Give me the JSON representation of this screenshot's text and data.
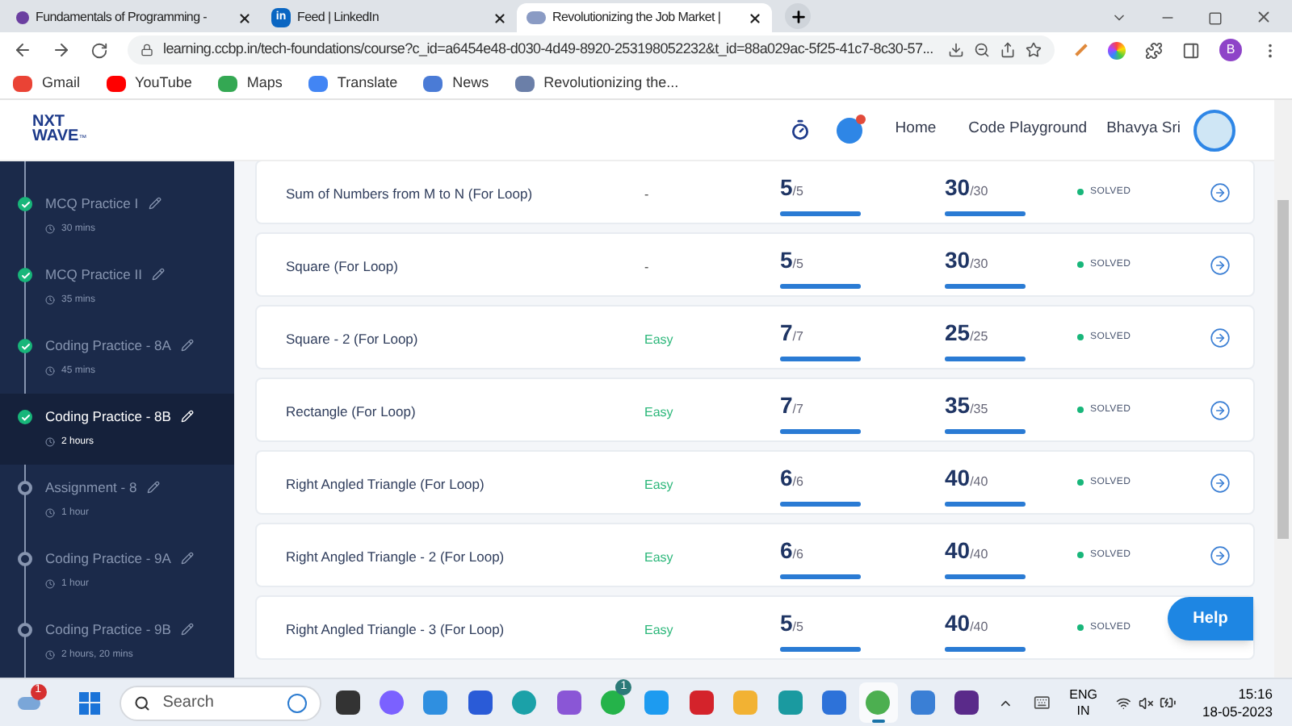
{
  "browser": {
    "tabs": [
      {
        "title": "Fundamentals of Programming -",
        "kind": "dot",
        "selected": false
      },
      {
        "title": "Feed | LinkedIn",
        "kind": "square",
        "logo_text": "in",
        "selected": false
      },
      {
        "title": "Revolutionizing the Job Market |",
        "kind": "site",
        "selected": true
      }
    ],
    "url": "learning.ccbp.in/tech-foundations/course?c_id=a6454e48-d030-4d49-8920-253198052232&t_id=88a029ac-5f25-41c7-8c30-57...",
    "profile_initial": "B",
    "bookmarks": [
      {
        "label": "Gmail",
        "kind": "gmail"
      },
      {
        "label": "YouTube",
        "kind": "youtube"
      },
      {
        "label": "Maps",
        "kind": "maps"
      },
      {
        "label": "Translate",
        "kind": "translate"
      },
      {
        "label": "News",
        "kind": "news"
      },
      {
        "label": "Revolutionizing the...",
        "kind": "site"
      }
    ]
  },
  "header": {
    "logo_top": "NXT",
    "logo_bottom": "WAVE",
    "logo_mark": "™",
    "nav": [
      "Home",
      "Code Playground"
    ],
    "user": "Bhavya Sri",
    "notification": true
  },
  "sidebar": {
    "items": [
      {
        "title": "MCQ Practice I",
        "duration": "30 mins",
        "completed": true,
        "selected": false
      },
      {
        "title": "MCQ Practice II",
        "duration": "35 mins",
        "completed": true,
        "selected": false
      },
      {
        "title": "Coding Practice - 8A",
        "duration": "45 mins",
        "completed": true,
        "selected": false
      },
      {
        "title": "Coding Practice - 8B",
        "duration": "2 hours",
        "completed": true,
        "selected": true
      },
      {
        "title": "Assignment - 8",
        "duration": "1 hour",
        "completed": false,
        "selected": false
      },
      {
        "title": "Coding Practice - 9A",
        "duration": "1 hour",
        "completed": false,
        "selected": false
      },
      {
        "title": "Coding Practice - 9B",
        "duration": "2 hours, 20 mins",
        "completed": false,
        "selected": false
      }
    ]
  },
  "questions": [
    {
      "name": "Sum of Numbers from M to N (For Loop)",
      "difficulty": "-",
      "tests": {
        "value": "5",
        "total": "/5",
        "level": 1
      },
      "score": {
        "value": "30",
        "total": "/30",
        "level": 1
      },
      "status": "SOLVED"
    },
    {
      "name": "Square (For Loop)",
      "difficulty": "-",
      "tests": {
        "value": "5",
        "total": "/5",
        "level": 1
      },
      "score": {
        "value": "30",
        "total": "/30",
        "level": 1
      },
      "status": "SOLVED"
    },
    {
      "name": "Square - 2 (For Loop)",
      "difficulty": "Easy",
      "tests": {
        "value": "7",
        "total": "/7",
        "level": 1
      },
      "score": {
        "value": "25",
        "total": "/25",
        "level": 1
      },
      "status": "SOLVED"
    },
    {
      "name": "Rectangle (For Loop)",
      "difficulty": "Easy",
      "tests": {
        "value": "7",
        "total": "/7",
        "level": 1
      },
      "score": {
        "value": "35",
        "total": "/35",
        "level": 1
      },
      "status": "SOLVED"
    },
    {
      "name": "Right Angled Triangle (For Loop)",
      "difficulty": "Easy",
      "tests": {
        "value": "6",
        "total": "/6",
        "level": 1
      },
      "score": {
        "value": "40",
        "total": "/40",
        "level": 1
      },
      "status": "SOLVED"
    },
    {
      "name": "Right Angled Triangle - 2 (For Loop)",
      "difficulty": "Easy",
      "tests": {
        "value": "6",
        "total": "/6",
        "level": 1
      },
      "score": {
        "value": "40",
        "total": "/40",
        "level": 1
      },
      "status": "SOLVED"
    },
    {
      "name": "Right Angled Triangle - 3 (For Loop)",
      "difficulty": "Easy",
      "tests": {
        "value": "5",
        "total": "/5",
        "level": 1
      },
      "score": {
        "value": "40",
        "total": "/40",
        "level": 1
      },
      "status": "SOLVED"
    }
  ],
  "help_button": "Help",
  "taskbar": {
    "weather_badge": "1",
    "search_placeholder": "Search",
    "apps": [
      {
        "kind": "tile",
        "active": false
      },
      {
        "kind": "meet",
        "active": false
      },
      {
        "kind": "help",
        "active": false
      },
      {
        "kind": "store",
        "active": false
      },
      {
        "kind": "edge",
        "active": false
      },
      {
        "kind": "copilot",
        "active": false
      },
      {
        "kind": "chat",
        "badge": "1",
        "active": false
      },
      {
        "kind": "bird",
        "active": false
      },
      {
        "kind": "shield",
        "active": false
      },
      {
        "kind": "folder",
        "active": false
      },
      {
        "kind": "ring",
        "active": false
      },
      {
        "kind": "check",
        "active": false
      },
      {
        "kind": "chrome",
        "active": true
      },
      {
        "kind": "photos",
        "active": false
      },
      {
        "kind": "ide",
        "active": false
      }
    ],
    "language": "ENG",
    "region": "IN",
    "time": "15:16",
    "date": "18-05-2023"
  }
}
